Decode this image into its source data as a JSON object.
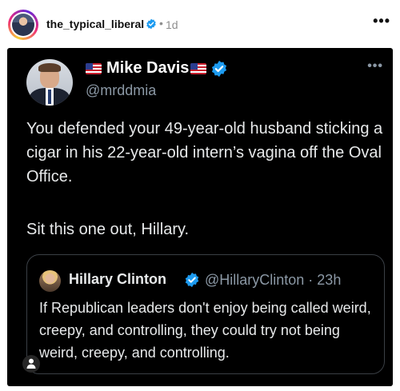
{
  "post": {
    "username": "the_typical_liberal",
    "separator": "•",
    "time_ago": "1d",
    "more_label": "•••"
  },
  "tweet": {
    "author_name": "Mike Davis",
    "author_handle": "@mrddmia",
    "more_label": "•••",
    "text_paragraph_1": "You defended your 49-year-old husband sticking a cigar in his 22-year-old intern’s vagina off the Oval Office.",
    "text_paragraph_2": "Sit this one out, Hillary.",
    "quoted": {
      "author_name": "Hillary Clinton",
      "author_handle": "@HillaryClinton · 23h",
      "text": "If Republican leaders don't enjoy being called weird, creepy, and controlling, they could try not being weird, creepy, and controlling."
    }
  },
  "colors": {
    "verified_blue": "#1d9bf0",
    "tweet_background": "#000000",
    "tweet_text": "#e7e9ea",
    "handle_gray": "#8b98a5"
  }
}
